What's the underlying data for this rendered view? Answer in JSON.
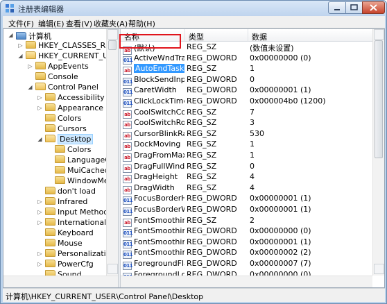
{
  "window": {
    "title": "注册表编辑器",
    "controls": {
      "minimize": "minimize-icon",
      "maximize": "maximize-icon",
      "close": "close-icon"
    }
  },
  "menu": [
    "文件(F)",
    "编辑(E)",
    "查看(V)",
    "收藏夹(A)",
    "帮助(H)"
  ],
  "tree": [
    {
      "label": "计算机",
      "depth": 0,
      "expander": "◢",
      "icon": "computer-icon"
    },
    {
      "label": "HKEY_CLASSES_ROOT",
      "depth": 1,
      "expander": "▷",
      "icon": "folder-icon"
    },
    {
      "label": "HKEY_CURRENT_USER",
      "depth": 1,
      "expander": "◢",
      "icon": "folder-icon"
    },
    {
      "label": "AppEvents",
      "depth": 2,
      "expander": "▷",
      "icon": "folder-icon"
    },
    {
      "label": "Console",
      "depth": 2,
      "expander": "",
      "icon": "folder-icon"
    },
    {
      "label": "Control Panel",
      "depth": 2,
      "expander": "◢",
      "icon": "folder-icon"
    },
    {
      "label": "Accessibility",
      "depth": 3,
      "expander": "▷",
      "icon": "folder-icon"
    },
    {
      "label": "Appearance",
      "depth": 3,
      "expander": "▷",
      "icon": "folder-icon"
    },
    {
      "label": "Colors",
      "depth": 3,
      "expander": "",
      "icon": "folder-icon"
    },
    {
      "label": "Cursors",
      "depth": 3,
      "expander": "",
      "icon": "folder-icon"
    },
    {
      "label": "Desktop",
      "depth": 3,
      "expander": "◢",
      "icon": "folder-icon",
      "selected": true
    },
    {
      "label": "Colors",
      "depth": 4,
      "expander": "",
      "icon": "folder-icon"
    },
    {
      "label": "LanguageCo",
      "depth": 4,
      "expander": "",
      "icon": "folder-icon"
    },
    {
      "label": "MuiCached",
      "depth": 4,
      "expander": "",
      "icon": "folder-icon"
    },
    {
      "label": "WindowMet",
      "depth": 4,
      "expander": "",
      "icon": "folder-icon"
    },
    {
      "label": "don't load",
      "depth": 3,
      "expander": "",
      "icon": "folder-icon"
    },
    {
      "label": "Infrared",
      "depth": 3,
      "expander": "▷",
      "icon": "folder-icon"
    },
    {
      "label": "Input Method",
      "depth": 3,
      "expander": "▷",
      "icon": "folder-icon"
    },
    {
      "label": "International",
      "depth": 3,
      "expander": "▷",
      "icon": "folder-icon"
    },
    {
      "label": "Keyboard",
      "depth": 3,
      "expander": "",
      "icon": "folder-icon"
    },
    {
      "label": "Mouse",
      "depth": 3,
      "expander": "",
      "icon": "folder-icon"
    },
    {
      "label": "Personalization",
      "depth": 3,
      "expander": "▷",
      "icon": "folder-icon"
    },
    {
      "label": "PowerCfg",
      "depth": 3,
      "expander": "▷",
      "icon": "folder-icon"
    },
    {
      "label": "Sound",
      "depth": 3,
      "expander": "",
      "icon": "folder-icon"
    }
  ],
  "columns": [
    "名称",
    "类型",
    "数据"
  ],
  "values": [
    {
      "name": "(默认)",
      "type": "REG_SZ",
      "data": "(数值未设置)",
      "icon": "ab"
    },
    {
      "name": "ActiveWndTrac...",
      "type": "REG_DWORD",
      "data": "0x00000000 (0)",
      "icon": "bin"
    },
    {
      "name": "AutoEndTasks",
      "type": "REG_SZ",
      "data": "1",
      "icon": "ab",
      "selected": true
    },
    {
      "name": "BlockSendInpu...",
      "type": "REG_DWORD",
      "data": "0",
      "icon": "bin"
    },
    {
      "name": "CaretWidth",
      "type": "REG_DWORD",
      "data": "0x00000001 (1)",
      "icon": "bin"
    },
    {
      "name": "ClickLockTime",
      "type": "REG_DWORD",
      "data": "0x000004b0 (1200)",
      "icon": "bin"
    },
    {
      "name": "CoolSwitchCol...",
      "type": "REG_SZ",
      "data": "7",
      "icon": "ab"
    },
    {
      "name": "CoolSwitchRows",
      "type": "REG_SZ",
      "data": "3",
      "icon": "ab"
    },
    {
      "name": "CursorBlinkRate",
      "type": "REG_SZ",
      "data": "530",
      "icon": "ab"
    },
    {
      "name": "DockMoving",
      "type": "REG_SZ",
      "data": "1",
      "icon": "ab"
    },
    {
      "name": "DragFromMaxi...",
      "type": "REG_SZ",
      "data": "1",
      "icon": "ab"
    },
    {
      "name": "DragFullWindo...",
      "type": "REG_SZ",
      "data": "0",
      "icon": "ab"
    },
    {
      "name": "DragHeight",
      "type": "REG_SZ",
      "data": "4",
      "icon": "ab"
    },
    {
      "name": "DragWidth",
      "type": "REG_SZ",
      "data": "4",
      "icon": "ab"
    },
    {
      "name": "FocusBorderH...",
      "type": "REG_DWORD",
      "data": "0x00000001 (1)",
      "icon": "bin"
    },
    {
      "name": "FocusBorderW...",
      "type": "REG_DWORD",
      "data": "0x00000001 (1)",
      "icon": "bin"
    },
    {
      "name": "FontSmoothing",
      "type": "REG_SZ",
      "data": "2",
      "icon": "ab"
    },
    {
      "name": "FontSmoothin...",
      "type": "REG_DWORD",
      "data": "0x00000000 (0)",
      "icon": "bin"
    },
    {
      "name": "FontSmoothin...",
      "type": "REG_DWORD",
      "data": "0x00000001 (1)",
      "icon": "bin"
    },
    {
      "name": "FontSmoothin...",
      "type": "REG_DWORD",
      "data": "0x00000002 (2)",
      "icon": "bin"
    },
    {
      "name": "ForegroundFla...",
      "type": "REG_DWORD",
      "data": "0x00000007 (7)",
      "icon": "bin"
    },
    {
      "name": "ForegroundLo...",
      "type": "REG_DWORD",
      "data": "0x00000000 (0)",
      "icon": "bin"
    }
  ],
  "status": {
    "path": "计算机\\HKEY_CURRENT_USER\\Control Panel\\Desktop"
  },
  "colors": {
    "selection": "#3399ff",
    "highlight_box": "#e0141c",
    "tree_selection": "#cde8ff"
  }
}
